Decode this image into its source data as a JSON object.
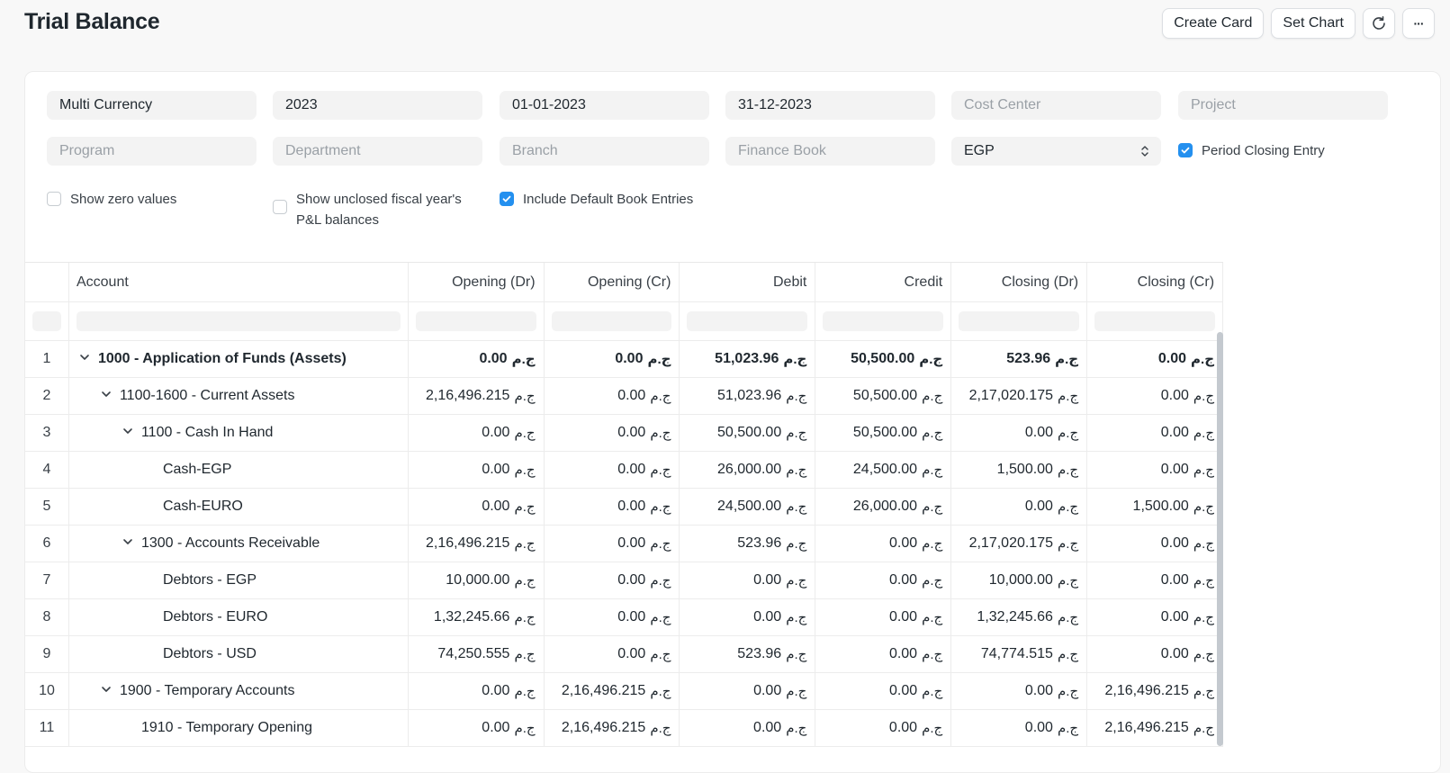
{
  "title": "Trial Balance",
  "actions": {
    "create_card": "Create Card",
    "set_chart": "Set Chart",
    "refresh_icon": "refresh-icon",
    "more": "···"
  },
  "filters": {
    "company": "Multi Currency",
    "fiscal_year": "2023",
    "from_date": "01-01-2023",
    "to_date": "31-12-2023",
    "cost_center_placeholder": "Cost Center",
    "project_placeholder": "Project",
    "program_placeholder": "Program",
    "department_placeholder": "Department",
    "branch_placeholder": "Branch",
    "finance_book_placeholder": "Finance Book",
    "currency": "EGP",
    "period_closing_entry": "Period Closing Entry",
    "show_zero_values": "Show zero values",
    "show_unclosed_line1": "Show unclosed fiscal year's",
    "show_unclosed_line2": "P&L balances",
    "include_default_book": "Include Default Book Entries"
  },
  "checkboxes": {
    "period_closing_entry": true,
    "show_zero_values": false,
    "show_unclosed": false,
    "include_default_book": true
  },
  "table": {
    "currency_symbol": "ج.م",
    "columns": [
      "Account",
      "Opening (Dr)",
      "Opening (Cr)",
      "Debit",
      "Credit",
      "Closing (Dr)",
      "Closing (Cr)"
    ],
    "rows": [
      {
        "num": "1",
        "account": "1000 - Application of Funds (Assets)",
        "indent": 0,
        "toggle": true,
        "bold": true,
        "values": [
          "0.00",
          "0.00",
          "51,023.96",
          "50,500.00",
          "523.96",
          "0.00"
        ]
      },
      {
        "num": "2",
        "account": "1100-1600 - Current Assets",
        "indent": 1,
        "toggle": true,
        "bold": false,
        "values": [
          "2,16,496.215",
          "0.00",
          "51,023.96",
          "50,500.00",
          "2,17,020.175",
          "0.00"
        ]
      },
      {
        "num": "3",
        "account": "1100 - Cash In Hand",
        "indent": 2,
        "toggle": true,
        "bold": false,
        "values": [
          "0.00",
          "0.00",
          "50,500.00",
          "50,500.00",
          "0.00",
          "0.00"
        ]
      },
      {
        "num": "4",
        "account": "Cash-EGP",
        "indent": 3,
        "toggle": false,
        "bold": false,
        "values": [
          "0.00",
          "0.00",
          "26,000.00",
          "24,500.00",
          "1,500.00",
          "0.00"
        ]
      },
      {
        "num": "5",
        "account": "Cash-EURO",
        "indent": 3,
        "toggle": false,
        "bold": false,
        "values": [
          "0.00",
          "0.00",
          "24,500.00",
          "26,000.00",
          "0.00",
          "1,500.00"
        ]
      },
      {
        "num": "6",
        "account": "1300 - Accounts Receivable",
        "indent": 2,
        "toggle": true,
        "bold": false,
        "values": [
          "2,16,496.215",
          "0.00",
          "523.96",
          "0.00",
          "2,17,020.175",
          "0.00"
        ]
      },
      {
        "num": "7",
        "account": "Debtors - EGP",
        "indent": 3,
        "toggle": false,
        "bold": false,
        "values": [
          "10,000.00",
          "0.00",
          "0.00",
          "0.00",
          "10,000.00",
          "0.00"
        ]
      },
      {
        "num": "8",
        "account": "Debtors - EURO",
        "indent": 3,
        "toggle": false,
        "bold": false,
        "values": [
          "1,32,245.66",
          "0.00",
          "0.00",
          "0.00",
          "1,32,245.66",
          "0.00"
        ]
      },
      {
        "num": "9",
        "account": "Debtors - USD",
        "indent": 3,
        "toggle": false,
        "bold": false,
        "values": [
          "74,250.555",
          "0.00",
          "523.96",
          "0.00",
          "74,774.515",
          "0.00"
        ]
      },
      {
        "num": "10",
        "account": "1900 - Temporary Accounts",
        "indent": 1,
        "toggle": true,
        "bold": false,
        "values": [
          "0.00",
          "2,16,496.215",
          "0.00",
          "0.00",
          "0.00",
          "2,16,496.215"
        ]
      },
      {
        "num": "11",
        "account": "1910 - Temporary Opening",
        "indent": 2,
        "toggle": false,
        "bold": false,
        "values": [
          "0.00",
          "2,16,496.215",
          "0.00",
          "0.00",
          "0.00",
          "2,16,496.215"
        ]
      }
    ]
  }
}
